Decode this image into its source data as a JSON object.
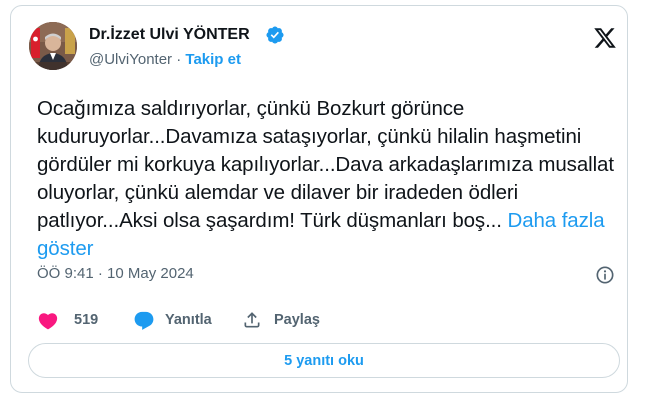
{
  "author": {
    "name": "Dr.İzzet Ulvi YÖNTER",
    "handle": "@UlviYonter",
    "separator": "·",
    "follow_label": "Takip et"
  },
  "tweet": {
    "text": "Ocağımıza saldırıyorlar, çünkü Bozkurt görünce kuduruyorlar...Davamıza sataşıyorlar, çünkü hilalin haşmetini gördüler mi korkuya kapılıyorlar...Dava arkadaşlarımıza musallat oluyorlar, çünkü alemdar ve dilaver bir iradeden ödleri patlıyor...Aksi olsa şaşardım! Türk düşmanları boş...",
    "show_more": "Daha fazla göster",
    "timestamp": "ÖÖ 9:41 · 10 May 2024"
  },
  "actions": {
    "likes": "519",
    "reply_label": "Yanıtla",
    "share_label": "Paylaş"
  },
  "replies_button": "5 yanıtı oku",
  "colors": {
    "accent": "#1d9bf0",
    "like": "#f91880",
    "text": "#0f1419",
    "muted": "#536471",
    "border": "#cfd9de"
  },
  "icons": [
    "verified-badge-icon",
    "x-logo-icon",
    "info-icon",
    "heart-icon",
    "reply-bubble-icon",
    "share-icon"
  ]
}
